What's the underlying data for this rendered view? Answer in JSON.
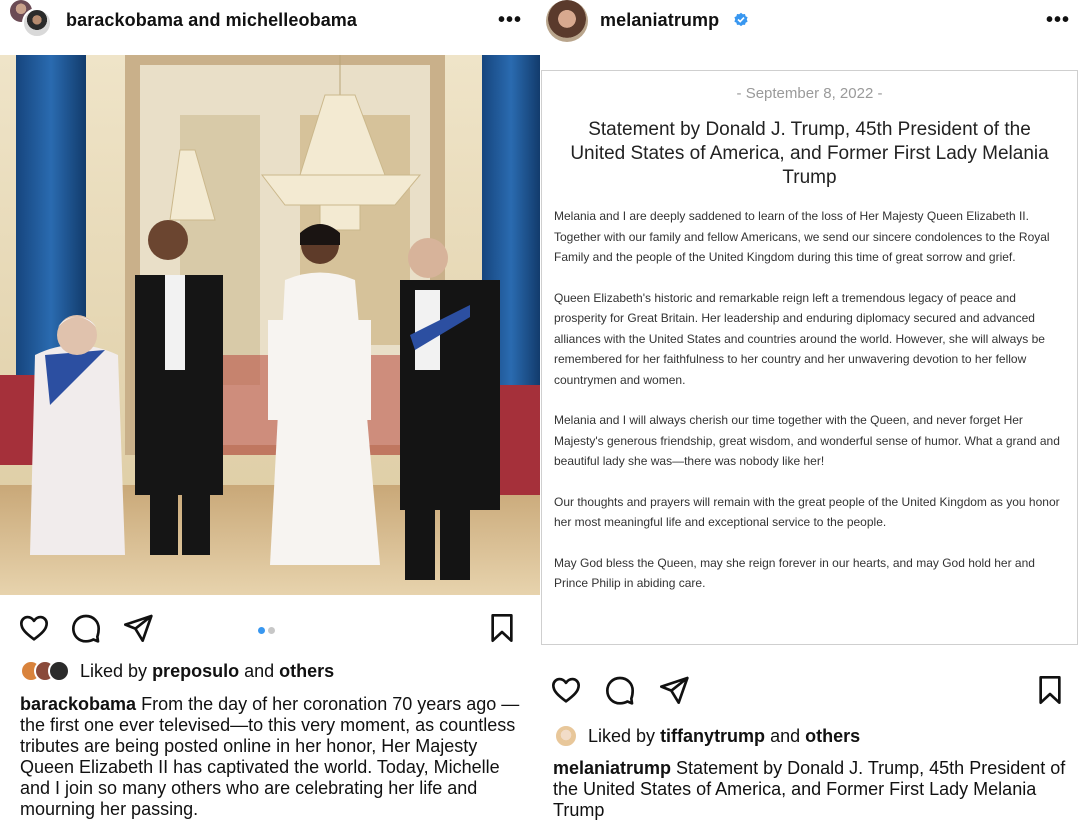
{
  "left_post": {
    "username": "barackobama and michelleobama",
    "more_label": "•••",
    "liked_by_prefix": "Liked by",
    "liked_by_user": "preposulo",
    "liked_by_and": "and",
    "liked_by_others": "others",
    "caption_user": "barackobama",
    "caption_text": "From the day of her coronation 70 years ago —the first one ever televised—to this very moment, as countless tributes are being posted online in her honor, Her Majesty Queen Elizabeth II has captivated the world. Today, Michelle and I join so many others who are celebrating her life and mourning her passing.",
    "carousel": {
      "count": 2,
      "active": 0
    }
  },
  "right_post": {
    "username": "melaniatrump",
    "verified": true,
    "more_label": "•••",
    "statement": {
      "date": "- September 8, 2022 -",
      "title": "Statement by Donald J. Trump, 45th President of the United States of America, and Former First Lady Melania Trump",
      "paragraphs": [
        "Melania and I are deeply saddened to learn of the loss of Her Majesty Queen Elizabeth II. Together with our family and fellow Americans, we send our sincere condolences to the Royal Family and the people of the United Kingdom during this time of great sorrow and grief.",
        "Queen Elizabeth's historic and remarkable reign left a tremendous legacy of peace and prosperity for Great Britain.  Her leadership and enduring diplomacy secured and advanced alliances with the United States and countries around the world.  However, she will always be remembered for her faithfulness to her country and her unwavering devotion to her fellow countrymen and women.",
        "Melania and I will always cherish our time together with the Queen, and never forget Her Majesty's generous friendship, great wisdom, and wonderful sense of humor.  What a grand and beautiful lady she was—there was nobody like her!",
        "Our thoughts and prayers will remain with the great people of the United Kingdom as you honor her most meaningful life and exceptional service to the people.",
        "May God bless the Queen, may she reign forever in our hearts, and may God hold her and Prince Philip in abiding care."
      ]
    },
    "liked_by_prefix": "Liked by",
    "liked_by_user": "tiffanytrump",
    "liked_by_and": "and",
    "liked_by_others": "others",
    "caption_user": "melaniatrump",
    "caption_text": "Statement by Donald J. Trump, 45th President of the United States of America, and Former First Lady Melania Trump"
  },
  "icons": {
    "like": "heart-icon",
    "comment": "comment-icon",
    "share": "share-icon",
    "save": "bookmark-icon",
    "verified": "verified-badge-icon"
  },
  "colors": {
    "verified_blue": "#3897f0",
    "carousel_active": "#3897f0",
    "carousel_inactive": "#c7c7c7",
    "text": "#111111"
  }
}
